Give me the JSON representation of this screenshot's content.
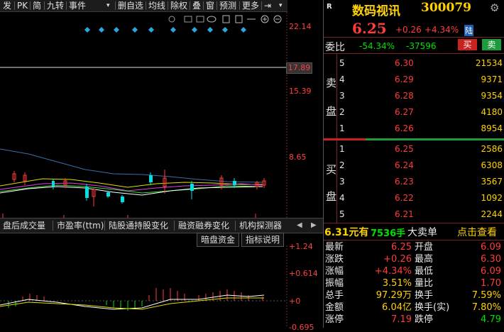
{
  "toolbar": {
    "items": [
      "发",
      "PK",
      "简",
      "九转",
      "事件",
      "▾",
      "删自选",
      "均线",
      "除权",
      "叠",
      "窗",
      "预测",
      "更多",
      "⇥",
      "▾"
    ]
  },
  "chart": {
    "axis_labels": [
      "22.14",
      "15.39",
      "8.65"
    ],
    "current_price_tag": "17.89",
    "indicator_axis": [
      "+1.24",
      "+0.614",
      "+0",
      "-0.695"
    ]
  },
  "tabs": [
    "盘后成交量",
    "市盈率(ttm)",
    "陆股通持股变化",
    "融资融券变化",
    "机构探测器"
  ],
  "sub_buttons": {
    "capital": "暗盘资金",
    "help": "指标说明"
  },
  "header": {
    "badge": "R",
    "stock_name": "数码视讯",
    "stock_code": "300079",
    "price": "6.25",
    "change": "+0.26",
    "change_pct": "+4.34%",
    "market_tag": "陆"
  },
  "commission": {
    "label": "委比",
    "ratio": "-54.34%",
    "diff": "-37596",
    "buy_btn": "买",
    "sell_btn": "卖"
  },
  "sell_side": {
    "label_top": "卖",
    "label_bottom": "盘",
    "rows": [
      {
        "level": "5",
        "price": "6.30",
        "volume": "21534"
      },
      {
        "level": "4",
        "price": "6.29",
        "volume": "9371"
      },
      {
        "level": "3",
        "price": "6.28",
        "volume": "9354"
      },
      {
        "level": "2",
        "price": "6.27",
        "volume": "4180"
      },
      {
        "level": "1",
        "price": "6.26",
        "volume": "8954"
      }
    ]
  },
  "buy_side": {
    "label_top": "买",
    "label_bottom": "盘",
    "rows": [
      {
        "level": "1",
        "price": "6.25",
        "volume": "2586"
      },
      {
        "level": "2",
        "price": "6.24",
        "volume": "6308"
      },
      {
        "level": "3",
        "price": "6.23",
        "volume": "3567"
      },
      {
        "level": "4",
        "price": "6.22",
        "volume": "1092"
      },
      {
        "level": "5",
        "price": "6.21",
        "volume": "2244"
      }
    ]
  },
  "big_order": {
    "amount": "6.31元有",
    "lots": "7536手",
    "label": "大卖单",
    "link": "点击查看"
  },
  "quote": {
    "rows": [
      {
        "l1": "最新",
        "v1": "6.25",
        "l2": "开盘",
        "v2": "6.09"
      },
      {
        "l1": "涨跌",
        "v1": "+0.26",
        "l2": "最高",
        "v2": "6.30"
      },
      {
        "l1": "涨幅",
        "v1": "+4.34%",
        "l2": "最低",
        "v2": "6.09"
      },
      {
        "l1": "振幅",
        "v1": "3.51%",
        "l2": "量比",
        "v2": "1.70"
      },
      {
        "l1": "总手",
        "v1": "97.29万",
        "l2": "换手",
        "v2": "7.59%"
      },
      {
        "l1": "金额",
        "v1": "6.04亿",
        "l2": "换手(实)",
        "v2": "7.80%"
      },
      {
        "l1": "涨停",
        "v1": "7.19",
        "l2": "跌停",
        "v2": "4.79"
      }
    ]
  },
  "colors": {
    "up": "#ff3c3c",
    "down": "#00e000",
    "accent": "#ffd200",
    "bg": "#000000"
  }
}
